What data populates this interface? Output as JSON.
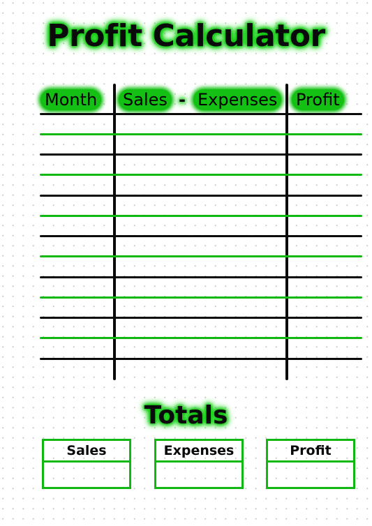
{
  "title": "Profit Calculator",
  "table": {
    "headers": [
      "Month",
      "Sales",
      "-",
      "Expenses",
      "Profit"
    ],
    "row_count": 6,
    "rows": [
      {
        "month": "",
        "sales_minus_expenses": "",
        "profit": ""
      },
      {
        "month": "",
        "sales_minus_expenses": "",
        "profit": ""
      },
      {
        "month": "",
        "sales_minus_expenses": "",
        "profit": ""
      },
      {
        "month": "",
        "sales_minus_expenses": "",
        "profit": ""
      },
      {
        "month": "",
        "sales_minus_expenses": "",
        "profit": ""
      },
      {
        "month": "",
        "sales_minus_expenses": "",
        "profit": ""
      },
      {
        "month": "",
        "sales_minus_expenses": "",
        "profit": ""
      }
    ]
  },
  "totals": {
    "heading": "Totals",
    "boxes": [
      {
        "label": "Sales",
        "value": ""
      },
      {
        "label": "Expenses",
        "value": ""
      },
      {
        "label": "Profit",
        "value": ""
      }
    ]
  },
  "colors": {
    "accent_green": "#11b811",
    "glow_green": "#12c312",
    "ink": "#0a0a0a"
  }
}
